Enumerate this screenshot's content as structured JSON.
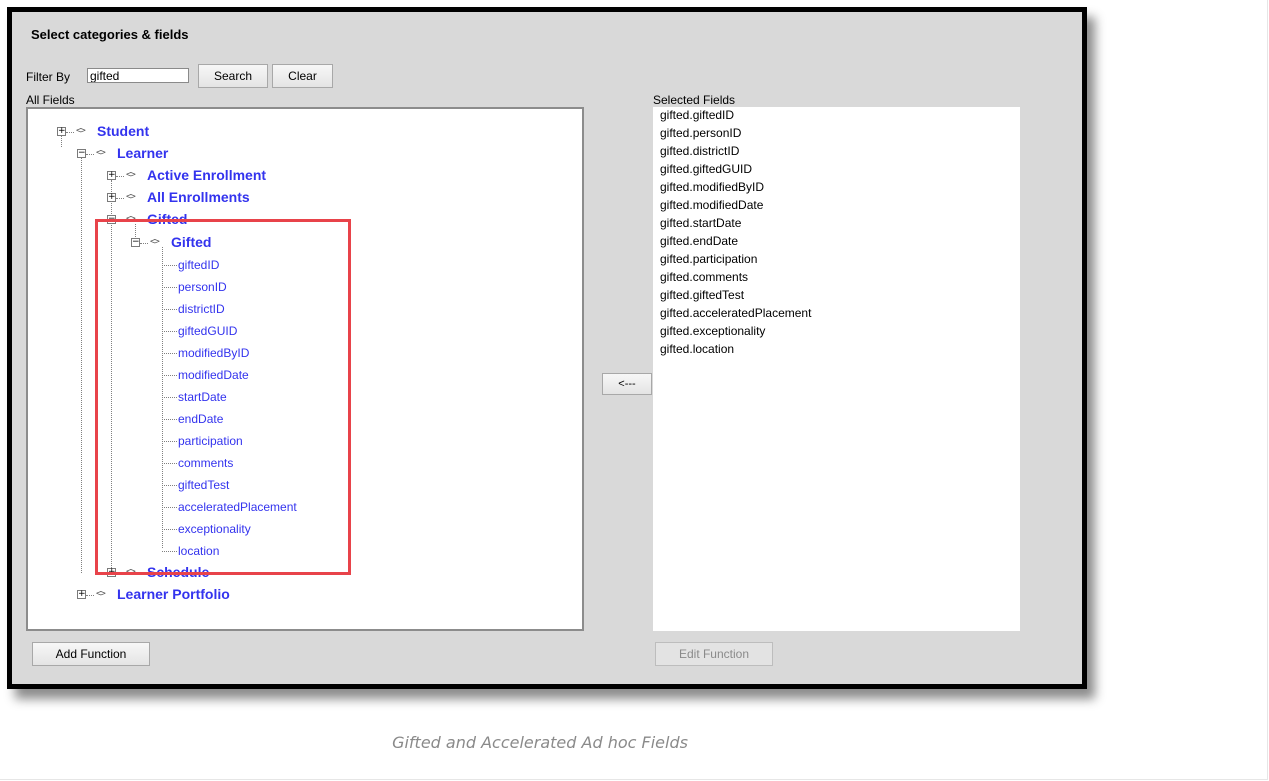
{
  "title": "Select categories & fields",
  "filter": {
    "label": "Filter By",
    "value": "gifted"
  },
  "buttons": {
    "search": "Search",
    "clear": "Clear",
    "move_left": "<---",
    "add_function": "Add Function",
    "edit_function": "Edit Function"
  },
  "all_fields_label": "All Fields",
  "selected_fields_label": "Selected Fields",
  "tree": {
    "student": "Student",
    "learner": "Learner",
    "active_enrollment": "Active Enrollment",
    "all_enrollments": "All Enrollments",
    "gifted_category": "Gifted",
    "gifted_table": "Gifted",
    "fields": [
      "giftedID",
      "personID",
      "districtID",
      "giftedGUID",
      "modifiedByID",
      "modifiedDate",
      "startDate",
      "endDate",
      "participation",
      "comments",
      "giftedTest",
      "acceleratedPlacement",
      "exceptionality",
      "location"
    ],
    "schedule": "Schedule",
    "learner_portfolio": "Learner Portfolio",
    "expand_symbol": "+",
    "collapse_symbol": "−",
    "icon_glyph": "<>"
  },
  "selected_fields": [
    "gifted.giftedID",
    "gifted.personID",
    "gifted.districtID",
    "gifted.giftedGUID",
    "gifted.modifiedByID",
    "gifted.modifiedDate",
    "gifted.startDate",
    "gifted.endDate",
    "gifted.participation",
    "gifted.comments",
    "gifted.giftedTest",
    "gifted.acceleratedPlacement",
    "gifted.exceptionality",
    "gifted.location"
  ],
  "caption": "Gifted and Accelerated Ad hoc Fields",
  "colors": {
    "link": "#3333ee",
    "highlight": "#e8434a",
    "panel_bg": "#d9d9d9"
  }
}
